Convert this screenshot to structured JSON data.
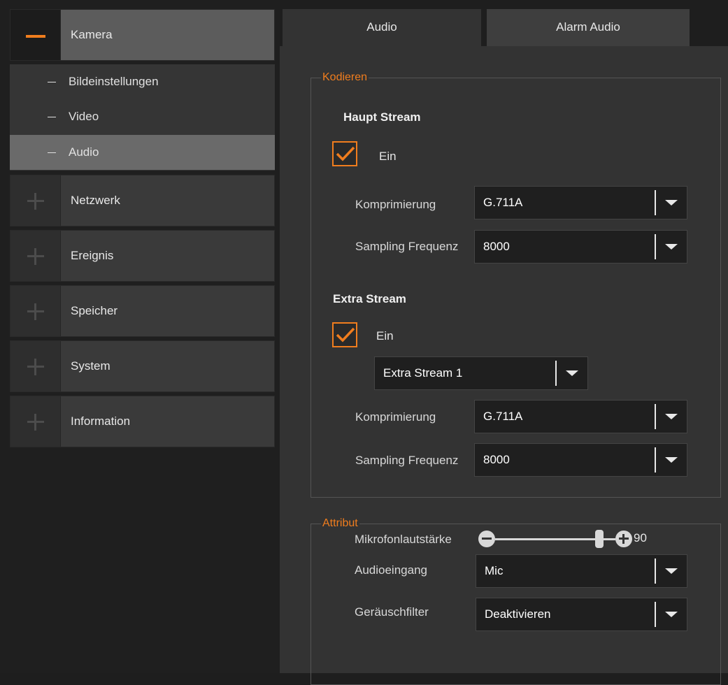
{
  "sidebar": {
    "categories": [
      {
        "label": "Kamera",
        "expanded": true
      },
      {
        "label": "Netzwerk",
        "expanded": false
      },
      {
        "label": "Ereignis",
        "expanded": false
      },
      {
        "label": "Speicher",
        "expanded": false
      },
      {
        "label": "System",
        "expanded": false
      },
      {
        "label": "Information",
        "expanded": false
      }
    ],
    "camera_subitems": [
      {
        "label": "Bildeinstellungen",
        "active": false
      },
      {
        "label": "Video",
        "active": false
      },
      {
        "label": "Audio",
        "active": true
      }
    ]
  },
  "tabs": [
    {
      "label": "Audio",
      "active": true
    },
    {
      "label": "Alarm Audio",
      "active": false
    }
  ],
  "encode": {
    "legend": "Kodieren",
    "main_stream": {
      "title": "Haupt Stream",
      "enabled_label": "Ein",
      "enabled": true,
      "compression_label": "Komprimierung",
      "compression_value": "G.711A",
      "sampling_label": "Sampling Frequenz",
      "sampling_value": "8000"
    },
    "extra_stream": {
      "title": "Extra Stream",
      "enabled_label": "Ein",
      "enabled": true,
      "stream_select_value": "Extra Stream 1",
      "compression_label": "Komprimierung",
      "compression_value": "G.711A",
      "sampling_label": "Sampling Frequenz",
      "sampling_value": "8000"
    }
  },
  "attribute": {
    "legend": "Attribut",
    "audio_input_label": "Audioeingang",
    "audio_input_value": "Mic",
    "noise_filter_label": "Geräuschfilter",
    "noise_filter_value": "Deaktivieren",
    "mic_volume_label": "Mikrofonlautstärke",
    "mic_volume_value": "90",
    "mic_volume_max": 100
  },
  "colors": {
    "accent": "#f07d1e",
    "sidebar_bg": "#1f1f1f",
    "panel_bg": "#333333",
    "select_bg": "#1f1f1f"
  }
}
